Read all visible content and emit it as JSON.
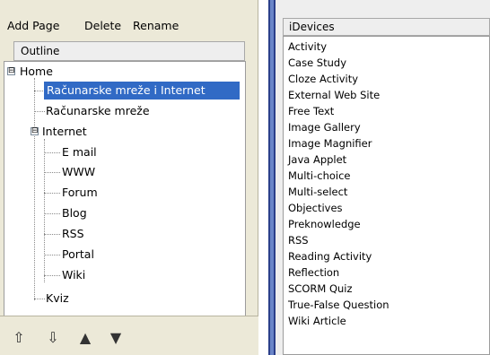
{
  "menu": {
    "add_page": "Add Page",
    "delete": "Delete",
    "rename": "Rename"
  },
  "outline": {
    "header": "Outline",
    "items": [
      {
        "label": "Home",
        "expander": "⊟",
        "selected": false
      },
      {
        "label": "Računarske mreže i Internet",
        "selected": true
      },
      {
        "label": "Računarske mreže",
        "selected": false
      },
      {
        "label": "Internet",
        "expander": "⊟",
        "selected": false
      },
      {
        "label": "E mail",
        "selected": false
      },
      {
        "label": "WWW",
        "selected": false
      },
      {
        "label": "Forum",
        "selected": false
      },
      {
        "label": "Blog",
        "selected": false
      },
      {
        "label": "RSS",
        "selected": false
      },
      {
        "label": "Portal",
        "selected": false
      },
      {
        "label": "Wiki",
        "selected": false
      },
      {
        "label": "Kviz",
        "selected": false
      }
    ]
  },
  "toolbar": {
    "icons": [
      "promote-icon",
      "demote-icon",
      "move-up-icon",
      "move-down-icon"
    ],
    "glyphs": [
      "⇧",
      "⇩",
      "▲",
      "▼"
    ]
  },
  "idevices": {
    "header": "iDevices",
    "items": [
      "Activity",
      "Case Study",
      "Cloze Activity",
      "External Web Site",
      "Free Text",
      "Image Gallery",
      "Image Magnifier",
      "Java Applet",
      "Multi-choice",
      "Multi-select",
      "Objectives",
      "Preknowledge",
      "RSS",
      "Reading Activity",
      "Reflection",
      "SCORM Quiz",
      "True-False Question",
      "Wiki Article"
    ]
  },
  "colors": {
    "selection": "#316ac5",
    "splitter": "#6a85c8",
    "panel_bg": "#ece9d8"
  }
}
